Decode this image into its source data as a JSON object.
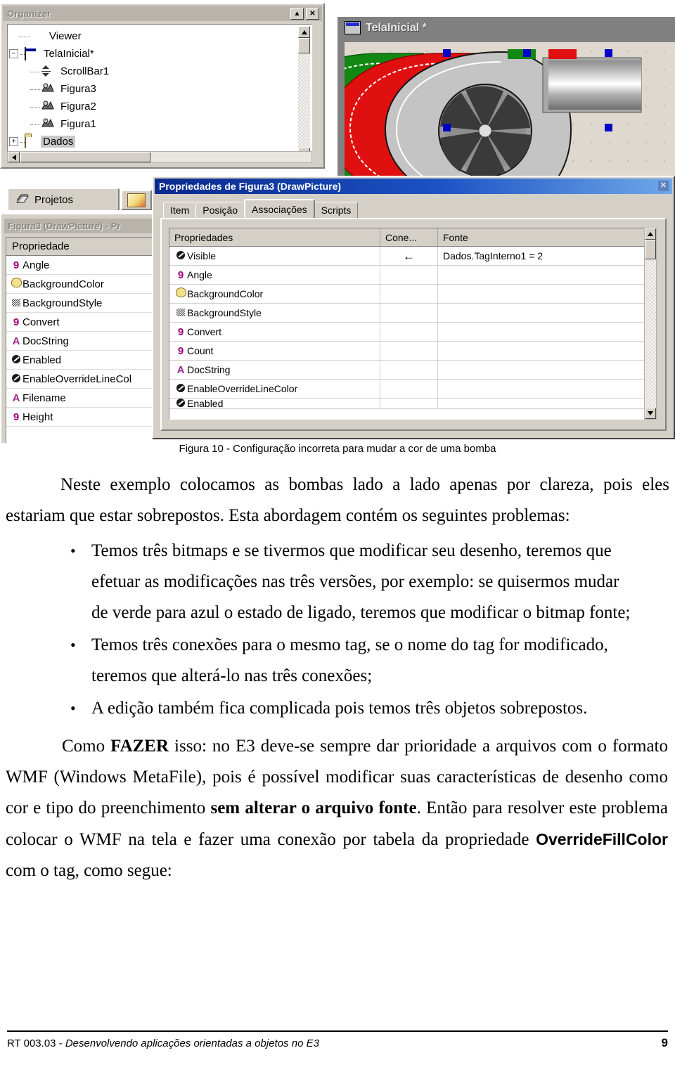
{
  "organizer": {
    "title": "Organizer",
    "buttons": [
      {
        "name": "restore-button",
        "glyph": "▲"
      },
      {
        "name": "close-button",
        "glyph": "✕"
      }
    ],
    "tree": [
      {
        "label": "Viewer",
        "icon": "viewer-icon",
        "expander": "",
        "indent": 1,
        "selected": false
      },
      {
        "label": "TelaInicial*",
        "icon": "screen-icon",
        "expander": "−",
        "indent": 0,
        "selected": false
      },
      {
        "label": "ScrollBar1",
        "icon": "scrollbar-icon",
        "expander": "",
        "indent": 2,
        "selected": false
      },
      {
        "label": "Figura3",
        "icon": "drawpicture-icon",
        "expander": "",
        "indent": 2,
        "selected": false
      },
      {
        "label": "Figura2",
        "icon": "drawpicture-icon",
        "expander": "",
        "indent": 2,
        "selected": false
      },
      {
        "label": "Figura1",
        "icon": "drawpicture-icon",
        "expander": "",
        "indent": 2,
        "selected": false
      },
      {
        "label": "Dados",
        "icon": "folder-icon",
        "expander": "+",
        "indent": 0,
        "selected": true
      }
    ]
  },
  "tabs": {
    "projetos_label": "Projetos"
  },
  "properties_panel": {
    "caption": "Figura3 (DrawPicture) - Pr",
    "column_header": "Propriedade",
    "rows": [
      {
        "type": "num",
        "label": "Angle"
      },
      {
        "type": "col",
        "label": "BackgroundColor"
      },
      {
        "type": "sty",
        "label": "BackgroundStyle"
      },
      {
        "type": "num",
        "label": "Convert"
      },
      {
        "type": "str",
        "label": "DocString"
      },
      {
        "type": "bool",
        "label": "Enabled"
      },
      {
        "type": "bool",
        "label": "EnableOverrideLineCol"
      },
      {
        "type": "str",
        "label": "Filename"
      },
      {
        "type": "num",
        "label": "Height"
      }
    ]
  },
  "editor": {
    "title": "TelaInicial *"
  },
  "dialog": {
    "title": "Propriedades de Figura3 (DrawPicture)",
    "close_glyph": "✕",
    "tabs": [
      {
        "label": "Item",
        "active": false
      },
      {
        "label": "Posição",
        "active": false
      },
      {
        "label": "Associações",
        "active": true
      },
      {
        "label": "Scripts",
        "active": false
      }
    ],
    "grid_headers": [
      "Propriedades",
      "Cone...",
      "Fonte"
    ],
    "grid_rows": [
      {
        "type": "bool",
        "property": "Visible",
        "conexao": "←",
        "fonte": "Dados.TagInterno1 = 2"
      },
      {
        "type": "num",
        "property": "Angle",
        "conexao": "",
        "fonte": ""
      },
      {
        "type": "col",
        "property": "BackgroundColor",
        "conexao": "",
        "fonte": ""
      },
      {
        "type": "sty",
        "property": "BackgroundStyle",
        "conexao": "",
        "fonte": ""
      },
      {
        "type": "num",
        "property": "Convert",
        "conexao": "",
        "fonte": ""
      },
      {
        "type": "num",
        "property": "Count",
        "conexao": "",
        "fonte": ""
      },
      {
        "type": "str",
        "property": "DocString",
        "conexao": "",
        "fonte": ""
      },
      {
        "type": "bool",
        "property": "EnableOverrideLineColor",
        "conexao": "",
        "fonte": ""
      },
      {
        "type": "bool",
        "property": "Enabled",
        "conexao": "",
        "fonte": ""
      }
    ]
  },
  "document": {
    "figure_caption": "Figura 10 - Configuração incorreta para mudar a cor de uma bomba",
    "paragraph_1": "Neste exemplo colocamos as bombas lado a lado apenas por clareza, pois eles estariam que estar sobrepostos. Esta abordagem contém os seguintes problemas:",
    "bullets": [
      "Temos três bitmaps e se tivermos que modificar seu desenho, teremos que efetuar as modificações nas três versões, por exemplo: se quisermos mudar de verde para azul o estado de ligado, teremos que modificar o bitmap fonte;",
      "Temos três conexões para o mesmo tag, se o nome do tag for modificado, teremos que alterá-lo nas três conexões;",
      "A edição também fica complicada pois temos três objetos sobrepostos."
    ],
    "paragraph_2_part1": "Como ",
    "paragraph_2_bold1": "FAZER",
    "paragraph_2_part2": " isso: no E3 deve-se sempre dar prioridade a arquivos com o formato WMF (Windows MetaFile), pois é possível modificar suas características de desenho como cor e tipo do preenchimento ",
    "paragraph_2_bold2": "sem alterar o arquivo fonte",
    "paragraph_2_part3": ". Então para resolver este problema colocar o WMF na tela e fazer uma conexão por tabela da propriedade ",
    "paragraph_2_bold3": "OverrideFillColor",
    "paragraph_2_part4": " com o tag, como segue:"
  },
  "footer": {
    "left_prefix": "RT 003.03 - ",
    "left_italic": "Desenvolvendo aplicações orientadas a objetos no E3",
    "page_number": "9"
  },
  "colors": {
    "pump_on": "#118811",
    "pump_alarm": "#e01010",
    "pump_off": "#b8b8b8",
    "selection_handle": "#0000c8",
    "dialog_titlebar": "#1c52c4",
    "window_face": "#d4d0c8"
  }
}
